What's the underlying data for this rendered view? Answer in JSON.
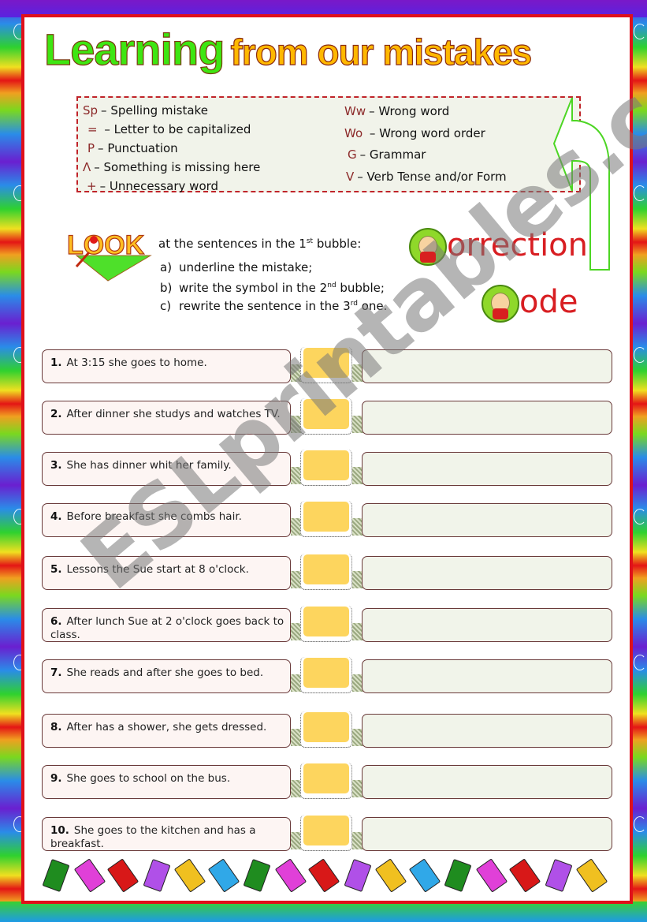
{
  "title": {
    "part1": "Learning",
    "part2": "from our mistakes"
  },
  "correction_code": {
    "left": [
      {
        "symbol": "Sp",
        "meaning": "– Spelling mistake"
      },
      {
        "symbol": "=",
        "meaning": " – Letter to be capitalized"
      },
      {
        "symbol": "P",
        "meaning": "–  Punctuation"
      },
      {
        "symbol": "Λ",
        "meaning": "– Something is missing here"
      },
      {
        "symbol": "+",
        "meaning": "– Unnecessary word"
      }
    ],
    "right": [
      {
        "symbol": "Ww",
        "meaning": "– Wrong word"
      },
      {
        "symbol": "Wo",
        "meaning": " – Wrong word order"
      },
      {
        "symbol": "G",
        "meaning": "–  Grammar"
      },
      {
        "symbol": "V",
        "meaning": "– Verb Tense and/or Form"
      }
    ]
  },
  "logo": {
    "look_text": "LOOK",
    "correction_word": "orrection",
    "code_word": "ode"
  },
  "instructions": {
    "lead": "at the sentences in the 1",
    "lead_sup": "st",
    "lead_end": " bubble:",
    "steps": [
      {
        "marker": "a)",
        "text": "underline the mistake;",
        "sup": "",
        "after": ""
      },
      {
        "marker": "b)",
        "text": "write the symbol in the 2",
        "sup": "nd",
        "after": " bubble;"
      },
      {
        "marker": "c)",
        "text": "rewrite the sentence in the 3",
        "sup": "rd",
        "after": " one."
      }
    ]
  },
  "exercises": [
    {
      "num": "1.",
      "sentence": "At 3:15 she goes to home."
    },
    {
      "num": "2.",
      "sentence": "After dinner she studys and watches TV."
    },
    {
      "num": "3.",
      "sentence": "She has dinner whit her family."
    },
    {
      "num": "4.",
      "sentence": "Before breakfast she combs hair."
    },
    {
      "num": "5.",
      "sentence": "Lessons the Sue start at 8 o'clock."
    },
    {
      "num": "6.",
      "sentence": "After lunch Sue at 2 o'clock goes back to class."
    },
    {
      "num": "7.",
      "sentence": "She reads and after she goes to bed."
    },
    {
      "num": "8.",
      "sentence": "After has a shower, she gets dressed."
    },
    {
      "num": "9.",
      "sentence": "She goes to school on the bus."
    },
    {
      "num": "10.",
      "sentence": "She goes to the kitchen and has a breakfast."
    }
  ],
  "watermark": "ESLprintables.com",
  "book_colors": [
    "#1f8c1f",
    "#e040d8",
    "#d81818",
    "#b050e8",
    "#f0c020",
    "#30a8e8",
    "#1f8c1f",
    "#e040d8",
    "#d81818",
    "#b050e8",
    "#f0c020",
    "#30a8e8",
    "#1f8c1f",
    "#e040d8",
    "#d81818",
    "#b050e8",
    "#f0c020"
  ]
}
